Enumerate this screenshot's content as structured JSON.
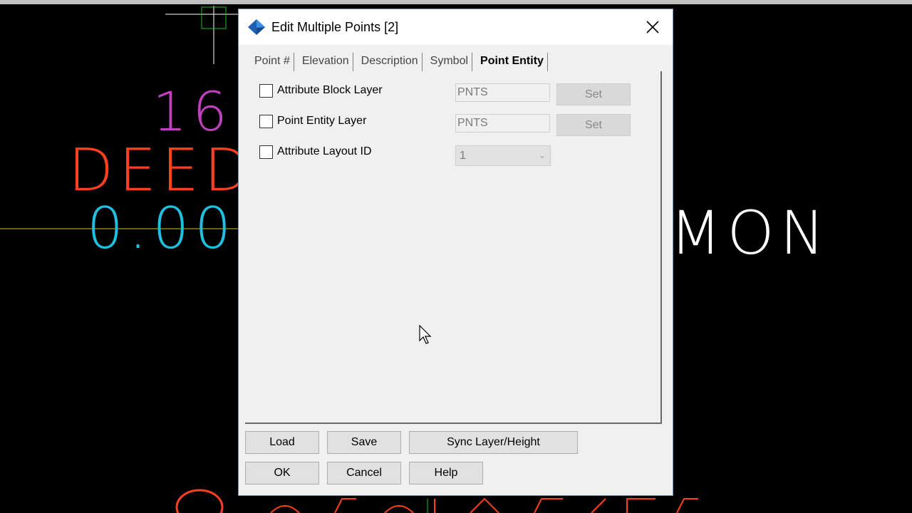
{
  "background": {
    "cad_texts": {
      "number": "16",
      "deed": "DEED",
      "elevation": "0.00",
      "mon": "MON"
    },
    "colors": {
      "number": "#c040c0",
      "deed": "#ff4020",
      "elevation": "#20c0e0",
      "mon": "#ffffff",
      "line": "#c8c820"
    }
  },
  "dialog": {
    "title": "Edit Multiple Points [2]",
    "close_icon": "close-icon",
    "tabs": [
      "Point #",
      "Elevation",
      "Description",
      "Symbol",
      "Point Entity"
    ],
    "active_tab": "Point Entity",
    "rows": [
      {
        "label": "Attribute Block Layer",
        "checked": false,
        "value": "PNTS",
        "button": "Set"
      },
      {
        "label": "Point Entity Layer",
        "checked": false,
        "value": "PNTS",
        "button": "Set"
      },
      {
        "label": "Attribute Layout ID",
        "checked": false,
        "value": "1"
      }
    ],
    "buttons": {
      "load": "Load",
      "save": "Save",
      "sync": "Sync Layer/Height",
      "ok": "OK",
      "cancel": "Cancel",
      "help": "Help"
    }
  }
}
